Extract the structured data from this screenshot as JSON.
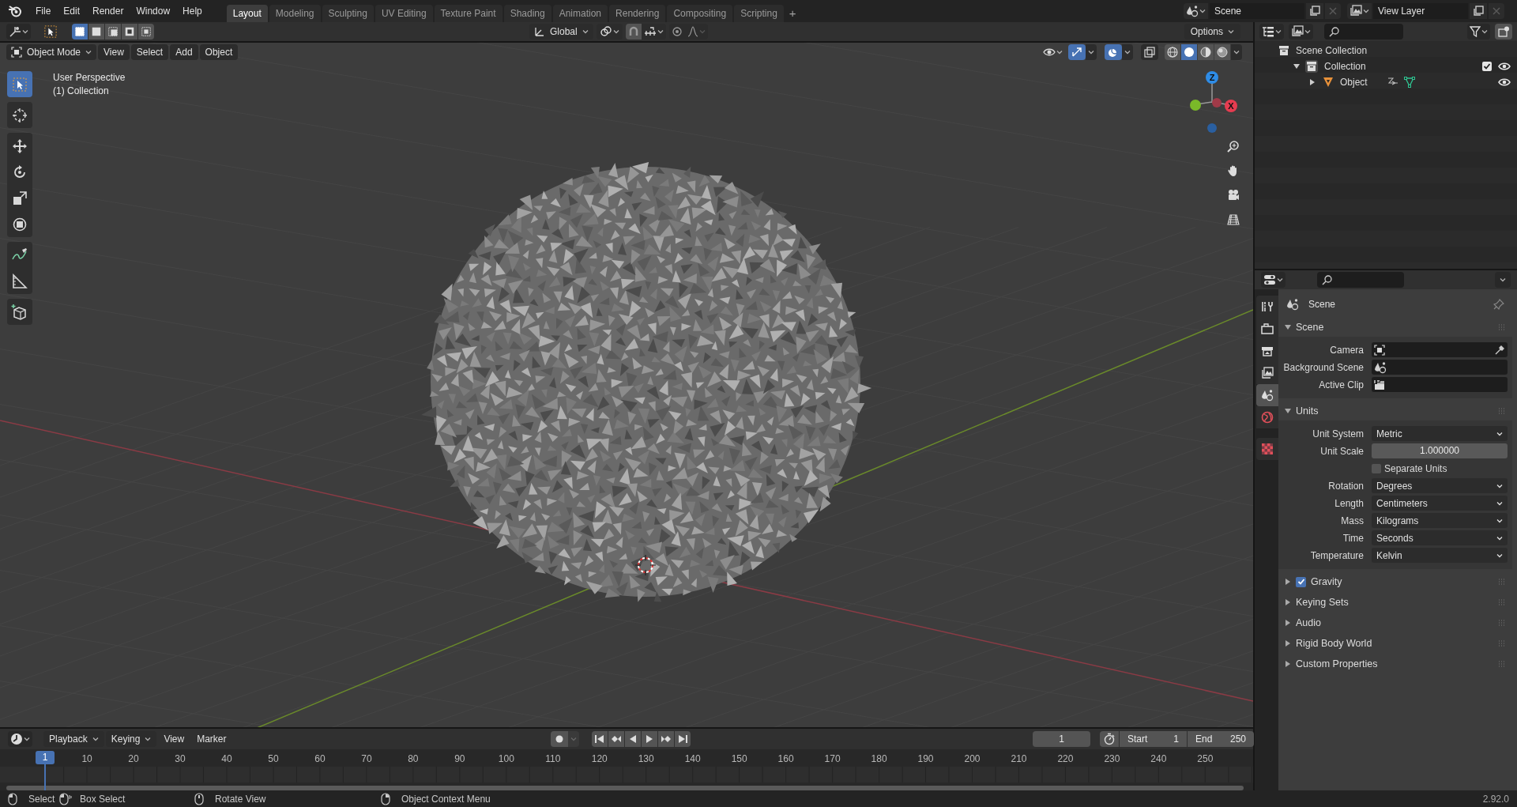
{
  "top_bar": {
    "menus": [
      "File",
      "Edit",
      "Render",
      "Window",
      "Help"
    ],
    "workspaces": [
      {
        "label": "Layout",
        "selected": true
      },
      {
        "label": "Modeling",
        "selected": false
      },
      {
        "label": "Sculpting",
        "selected": false
      },
      {
        "label": "UV Editing",
        "selected": false
      },
      {
        "label": "Texture Paint",
        "selected": false
      },
      {
        "label": "Shading",
        "selected": false
      },
      {
        "label": "Animation",
        "selected": false
      },
      {
        "label": "Rendering",
        "selected": false
      },
      {
        "label": "Compositing",
        "selected": false
      },
      {
        "label": "Scripting",
        "selected": false
      }
    ],
    "add_workspace": "+",
    "scene": "Scene",
    "view_layer": "View Layer"
  },
  "viewport": {
    "tool_header": {
      "select_modes": [
        {
          "selected": true
        },
        {
          "selected": false
        },
        {
          "selected": false
        },
        {
          "selected": false
        },
        {
          "selected": false
        }
      ],
      "orientation": "Global",
      "options": "Options"
    },
    "header": {
      "mode": "Object Mode",
      "menus": [
        "View",
        "Select",
        "Add",
        "Object"
      ],
      "shading_modes": [
        {
          "kind": "wireframe",
          "selected": false
        },
        {
          "kind": "solid",
          "selected": true
        },
        {
          "kind": "material",
          "selected": false
        },
        {
          "kind": "rendered",
          "selected": false
        }
      ]
    },
    "overlay_text": [
      "User Perspective",
      "(1) Collection"
    ],
    "tools": [
      {
        "kind": "select",
        "selected": true
      },
      {
        "kind": "cursor",
        "selected": false
      },
      {
        "kind": "move",
        "selected": false
      },
      {
        "kind": "rotate",
        "selected": false
      },
      {
        "kind": "scale",
        "selected": false
      },
      {
        "kind": "transform",
        "selected": false
      },
      {
        "kind": "annotate",
        "selected": false
      },
      {
        "kind": "measure",
        "selected": false
      },
      {
        "kind": "add_cube",
        "selected": false
      }
    ],
    "gizmo": {
      "z": "Z",
      "x": "X"
    }
  },
  "outliner": {
    "items": [
      {
        "kind": "root",
        "label": "Scene Collection",
        "children": [
          {
            "kind": "collection",
            "label": "Collection",
            "expanded": true,
            "checked": true,
            "children": [
              {
                "kind": "object",
                "label": "Object",
                "expanded": false
              }
            ]
          }
        ]
      }
    ]
  },
  "properties": {
    "tabs": [
      {
        "kind": "tool",
        "selected": false
      },
      {
        "kind": "render",
        "selected": false
      },
      {
        "kind": "output",
        "selected": false
      },
      {
        "kind": "view_layer",
        "selected": false
      },
      {
        "kind": "scene",
        "selected": true
      },
      {
        "kind": "world",
        "selected": false
      },
      {
        "kind": "texture",
        "selected": false
      }
    ],
    "context": "Scene",
    "panels": [
      {
        "title": "Scene",
        "expanded": true,
        "rows": [
          {
            "kind": "camera_field",
            "label": "Camera"
          },
          {
            "kind": "scene_field",
            "label": "Background Scene"
          },
          {
            "kind": "clip_field",
            "label": "Active Clip"
          }
        ]
      },
      {
        "title": "Units",
        "expanded": true,
        "rows": [
          {
            "kind": "dropdown",
            "label": "Unit System",
            "value": "Metric"
          },
          {
            "kind": "number",
            "label": "Unit Scale",
            "value": "1.000000"
          },
          {
            "kind": "checkbox",
            "label": "Separate Units",
            "checked": false
          },
          {
            "kind": "dropdown",
            "label": "Rotation",
            "value": "Degrees"
          },
          {
            "kind": "dropdown",
            "label": "Length",
            "value": "Centimeters"
          },
          {
            "kind": "dropdown",
            "label": "Mass",
            "value": "Kilograms"
          },
          {
            "kind": "dropdown",
            "label": "Time",
            "value": "Seconds"
          },
          {
            "kind": "dropdown",
            "label": "Temperature",
            "value": "Kelvin"
          }
        ]
      },
      {
        "title": "Gravity",
        "expanded": false,
        "checked": true
      },
      {
        "title": "Keying Sets",
        "expanded": false
      },
      {
        "title": "Audio",
        "expanded": false
      },
      {
        "title": "Rigid Body World",
        "expanded": false
      },
      {
        "title": "Custom Properties",
        "expanded": false
      }
    ]
  },
  "timeline": {
    "menus": [
      {
        "label": "Playback",
        "dropdown": true
      },
      {
        "label": "Keying",
        "dropdown": true
      },
      {
        "label": "View",
        "dropdown": false
      },
      {
        "label": "Marker",
        "dropdown": false
      }
    ],
    "current_frame": "1",
    "start_label": "Start",
    "start": "1",
    "end_label": "End",
    "end": "250",
    "ruler": [
      "1",
      "10",
      "20",
      "30",
      "40",
      "50",
      "60",
      "70",
      "80",
      "90",
      "100",
      "110",
      "120",
      "130",
      "140",
      "150",
      "160",
      "170",
      "180",
      "190",
      "200",
      "210",
      "220",
      "230",
      "240",
      "250"
    ]
  },
  "status_bar": {
    "hints": [
      {
        "kind": "left_click",
        "label": "Select"
      },
      {
        "kind": "drag",
        "label": "Box Select"
      },
      {
        "kind": "middle_click",
        "label": "Rotate View"
      },
      {
        "kind": "right_click",
        "label": "Object Context Menu"
      }
    ],
    "version": "2.92.0"
  }
}
